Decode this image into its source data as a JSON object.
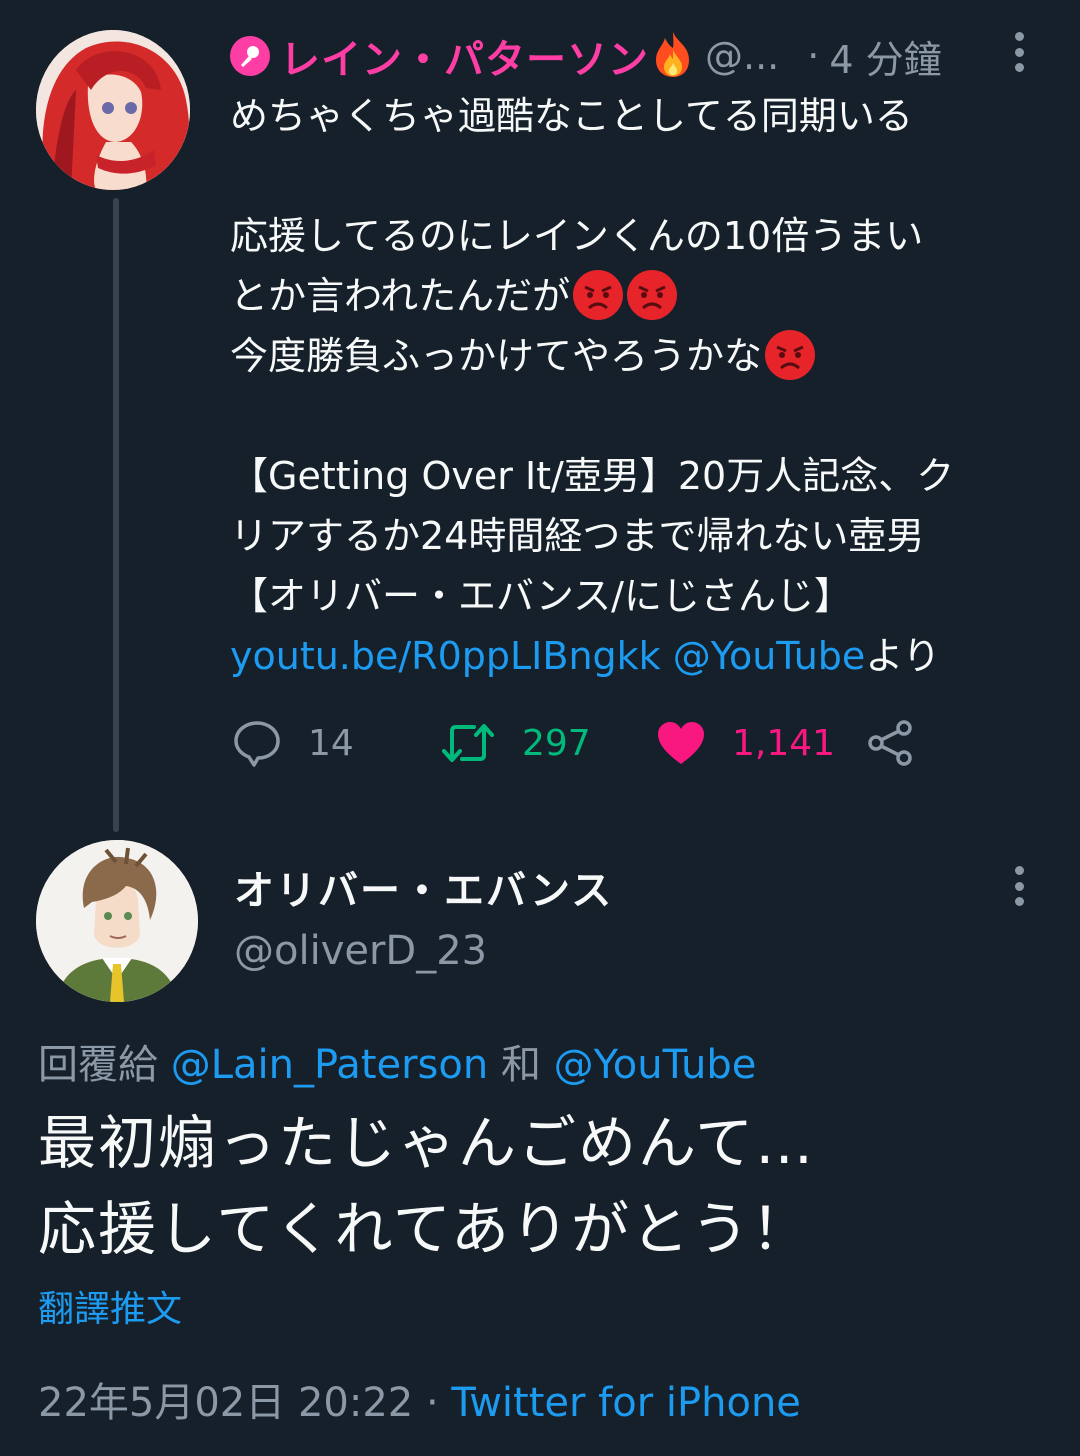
{
  "parent_tweet": {
    "author_name": "レイン・パターソン",
    "author_handle": "@...",
    "separator": "·",
    "time_ago": "4 分鐘",
    "body_lines": [
      "めちゃくちゃ過酷なことしてる同期いる",
      "応援してるのにレインくんの10倍うまい",
      "とか言われたんだが",
      "今度勝負ふっかけてやろうかな",
      "【Getting Over It/壺男】20万人記念、ク",
      "リアするか24時間経つまで帰れない壺男",
      "【オリバー・エバンス/にじさんじ】"
    ],
    "link_url": "youtu.be/R0ppLIBngkk",
    "link_mention": "@YouTube",
    "link_suffix": "より",
    "counts": {
      "replies": "14",
      "retweets": "297",
      "likes": "1,141"
    },
    "icons": [
      "microphone-badge-icon",
      "fire-icon",
      "angry-face-emoji",
      "reply-icon",
      "retweet-icon",
      "heart-icon",
      "share-icon",
      "more-icon"
    ]
  },
  "reply_tweet": {
    "author_name": "オリバー・エバンス",
    "author_handle": "@oliverD_23",
    "replying_prefix": "回覆給",
    "replying_to_1": "@Lain_Paterson",
    "replying_and": "和",
    "replying_to_2": "@YouTube",
    "text_lines": [
      "最初煽ったじゃんごめんて…",
      "応援してくれてありがとう！"
    ],
    "translate_label": "翻譯推文",
    "timestamp": "22年5月02日 20:22",
    "meta_separator": "·",
    "source": "Twitter for iPhone"
  },
  "colors": {
    "background": "#15202b",
    "name_pink": "#ff3ea5",
    "link_blue": "#1d9bf0",
    "retweet_green": "#00ba7c",
    "like_pink": "#f91880",
    "muted": "#8b98a5"
  }
}
